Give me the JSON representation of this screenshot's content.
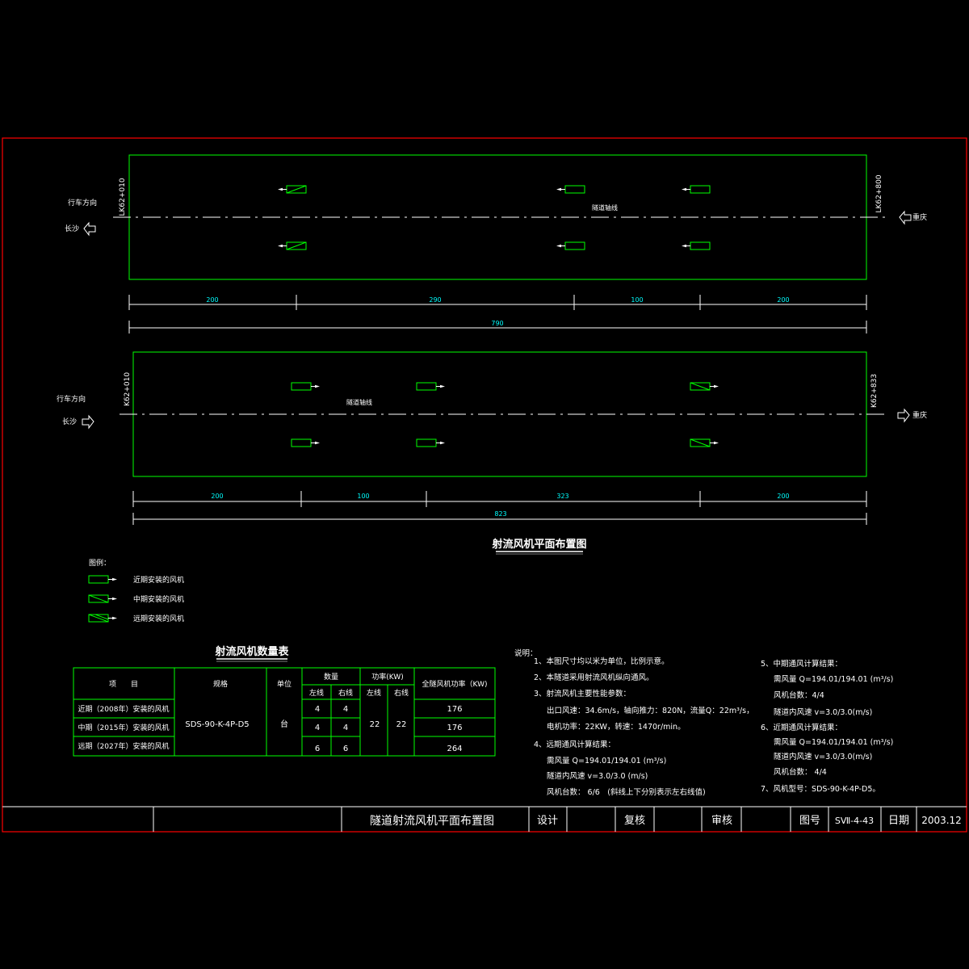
{
  "colors": {
    "background": "#000000",
    "frame": "#ff0000",
    "outline": "#00ff00",
    "dimension_text": "#00ffff",
    "text": "#ffffff"
  },
  "plan_upper": {
    "chainage_left": "LK62+010",
    "chainage_right": "LK62+800",
    "direction_label": "行车方向",
    "left_city": "长沙",
    "right_city": "重庆",
    "axis_label": "隧道轴线",
    "dims": [
      "200",
      "290",
      "100",
      "200"
    ],
    "total": "790"
  },
  "plan_lower": {
    "chainage_left": "K62+010",
    "chainage_right": "K62+833",
    "direction_label": "行车方向",
    "left_city": "长沙",
    "right_city": "重庆",
    "axis_label": "隧道轴线",
    "dims": [
      "200",
      "100",
      "323",
      "200"
    ],
    "total": "823"
  },
  "plan_title": "射流风机平面布置图",
  "legend": {
    "title": "图例：",
    "items": [
      {
        "label": "近期安装的风机",
        "icon": "fan-near-icon"
      },
      {
        "label": "中期安装的风机",
        "icon": "fan-mid-icon"
      },
      {
        "label": "远期安装的风机",
        "icon": "fan-far-icon"
      }
    ]
  },
  "table": {
    "title": "射流风机数量表",
    "headers": {
      "item": "项　　目",
      "spec": "规格",
      "unit": "单位",
      "qty": "数量",
      "power": "功率(KW)",
      "left": "左线",
      "right": "右线",
      "total_power": "全隧风机功率（KW)"
    },
    "rows": [
      {
        "item": "近期（2008年）安装的风机",
        "qty_left": "4",
        "qty_right": "4",
        "total": "176"
      },
      {
        "item": "中期（2015年）安装的风机",
        "qty_left": "4",
        "qty_right": "4",
        "total": "176"
      },
      {
        "item": "远期（2027年）安装的风机",
        "qty_left": "6",
        "qty_right": "6",
        "total": "264"
      }
    ],
    "spec": "SDS-90-K-4P-D5",
    "unit": "台",
    "power_left": "22",
    "power_right": "22"
  },
  "notes_left": [
    "说明：",
    "1、本图尺寸均以米为单位，比例示意。",
    "2、本隧道采用射流风机纵向通风。",
    "3、射流风机主要性能参数：",
    "出口风速：34.6m/s，轴向推力：820N，流量Q：22m³/s，",
    "电机功率：22KW，转速：1470r/min。",
    "4、远期通风计算结果：",
    "需风量 Q=194.01/194.01 (m³/s)",
    "隧道内风速 v=3.0/3.0 (m/s)",
    "风机台数： 6/6　(斜线上下分别表示左右线值)"
  ],
  "notes_right": [
    "5、中期通风计算结果：",
    "需风量 Q=194.01/194.01 (m³/s)",
    "风机台数：4/4",
    "隧道内风速 v=3.0/3.0(m/s)",
    "6、近期通风计算结果：",
    "需风量 Q=194.01/194.01 (m³/s)",
    "隧道内风速 v=3.0/3.0(m/s)",
    "风机台数： 4/4",
    "7、风机型号：SDS-90-K-4P-D5。"
  ],
  "title_block": {
    "drawing_name": "隧道射流风机平面布置图",
    "design": "设计",
    "review": "复核",
    "approve": "审核",
    "drawing_no_label": "图号",
    "drawing_no": "SⅦ-4-43",
    "date_label": "日期",
    "date": "2003.12"
  }
}
